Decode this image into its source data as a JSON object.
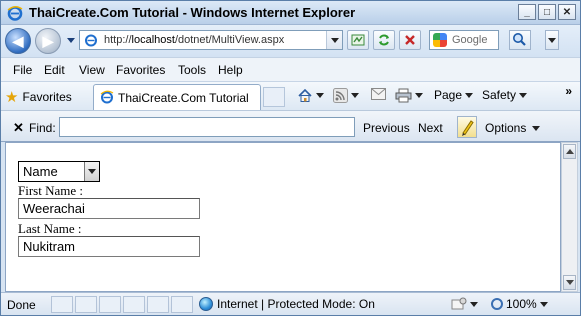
{
  "window": {
    "title": "ThaiCreate.Com Tutorial - Windows Internet Explorer",
    "controls": [
      "_",
      "□",
      "✕"
    ]
  },
  "address_bar": {
    "url_prefix": "http://",
    "url_host": "localhost",
    "url_path": "/dotnet/MultiView.aspx",
    "search_placeholder": "Google"
  },
  "menu": {
    "items": [
      "File",
      "Edit",
      "View",
      "Favorites",
      "Tools",
      "Help"
    ]
  },
  "favorites_bar": {
    "favorites_label": "Favorites",
    "tab_title": "ThaiCreate.Com Tutorial",
    "page_label": "Page",
    "safety_label": "Safety",
    "overflow": "»"
  },
  "find_bar": {
    "label": "Find:",
    "value": "",
    "previous": "Previous",
    "next": "Next",
    "options": "Options"
  },
  "page": {
    "select_value": "Name",
    "first_name_label": "First Name :",
    "first_name_value": "Weerachai",
    "last_name_label": "Last Name :",
    "last_name_value": "Nukitram"
  },
  "status_bar": {
    "status": "Done",
    "zone": "Internet | Protected Mode: On",
    "zoom": "100%"
  }
}
